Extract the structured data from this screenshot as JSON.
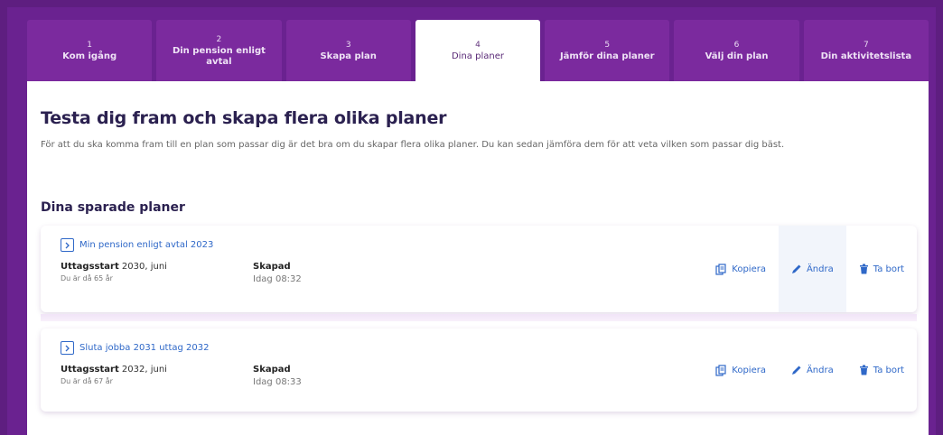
{
  "tabs": [
    {
      "num": "1",
      "label": "Kom igång"
    },
    {
      "num": "2",
      "label": "Din pension enligt avtal"
    },
    {
      "num": "3",
      "label": "Skapa plan"
    },
    {
      "num": "4",
      "label": "Dina planer"
    },
    {
      "num": "5",
      "label": "Jämför dina planer"
    },
    {
      "num": "6",
      "label": "Välj din plan"
    },
    {
      "num": "7",
      "label": "Din aktivitetslista"
    }
  ],
  "active_tab": 4,
  "heading": "Testa dig fram och skapa flera olika planer",
  "intro": "För att du ska komma fram till en plan som passar dig är det bra om du skapar flera olika planer. Du kan sedan jämföra dem för att veta vilken som passar dig bäst.",
  "saved_heading": "Dina sparade planer",
  "plans": [
    {
      "title": "Min pension enligt avtal 2023",
      "start_label": "Uttagsstart",
      "start_value": "2030, juni",
      "start_sub": "Du är då 65 år",
      "created_label": "Skapad",
      "created_value": "Idag 08:32",
      "copy": "Kopiera",
      "edit": "Ändra",
      "delete": "Ta bort"
    },
    {
      "title": "Sluta jobba 2031 uttag 2032",
      "start_label": "Uttagsstart",
      "start_value": "2032, juni",
      "start_sub": "Du är då 67 år",
      "created_label": "Skapad",
      "created_value": "Idag 08:33",
      "copy": "Kopiera",
      "edit": "Ändra",
      "delete": "Ta bort"
    }
  ],
  "colors": {
    "frame": "#5e1e80",
    "tab": "#7b2a9e",
    "active_tab": "#ffffff",
    "heading": "#2b2150",
    "link": "#2f68c8"
  },
  "icons": {
    "expand": "chevron-right-icon",
    "copy": "copy-icon",
    "edit": "pencil-icon",
    "delete": "trash-icon"
  }
}
